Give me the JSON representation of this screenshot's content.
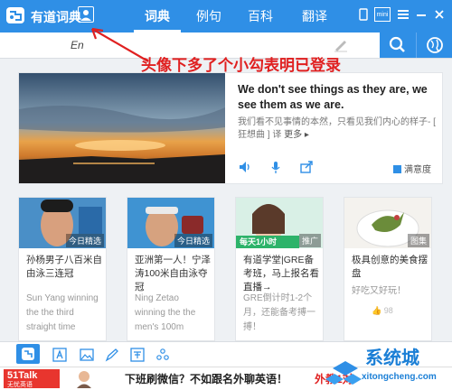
{
  "app": {
    "name": "有道词典"
  },
  "tabs": [
    {
      "label": "词典",
      "active": true
    },
    {
      "label": "例句",
      "active": false
    },
    {
      "label": "百科",
      "active": false
    },
    {
      "label": "翻译",
      "active": false
    }
  ],
  "window_controls": {
    "mini_label": "mini"
  },
  "search": {
    "lang": "En",
    "value": "",
    "placeholder": ""
  },
  "annotation": {
    "text": "头像下多了个小勾表明已登录",
    "color": "#e02020"
  },
  "feature": {
    "quote_en": "We don't see things as they are, we see them as we are.",
    "quote_zh": "我们看不见事情的本然，只看见我们内心的样子- [ 狂想曲 ] 译",
    "more_label": "更多 ▸",
    "satisfaction_label": "满意度"
  },
  "cards": [
    {
      "image_tag": "今日精选",
      "title": "孙杨男子八百米自由泳三连冠",
      "summary": "Sun Yang winning the the third straight time",
      "likes": ""
    },
    {
      "image_tag": "今日精选",
      "title": "亚洲第一人！宁泽涛100米自由泳夺冠",
      "summary": "Ning Zetao winning the the men's 100m",
      "likes": ""
    },
    {
      "image_tag": "推广",
      "title": "有道学堂|GRE备考班，马上报名看直播→",
      "summary": "GRE倒计时1-2个月，还能备考搏一搏！",
      "likes": ""
    },
    {
      "image_tag": "图集",
      "title": "极具创意的美食摆盘",
      "summary": "好吃又好玩！",
      "likes": "98"
    }
  ],
  "ad": {
    "logo_line1": "51Talk",
    "logo_line2": "无忧英语",
    "text": "下班刷微信？不如跟名外聊英语！",
    "text_red": "外教1对"
  },
  "watermark": {
    "brand": "系统城",
    "url": "xitongcheng.com"
  },
  "colors": {
    "brand_blue": "#2f8fe6",
    "annotation_red": "#e02020",
    "ad_red": "#e8352e"
  }
}
